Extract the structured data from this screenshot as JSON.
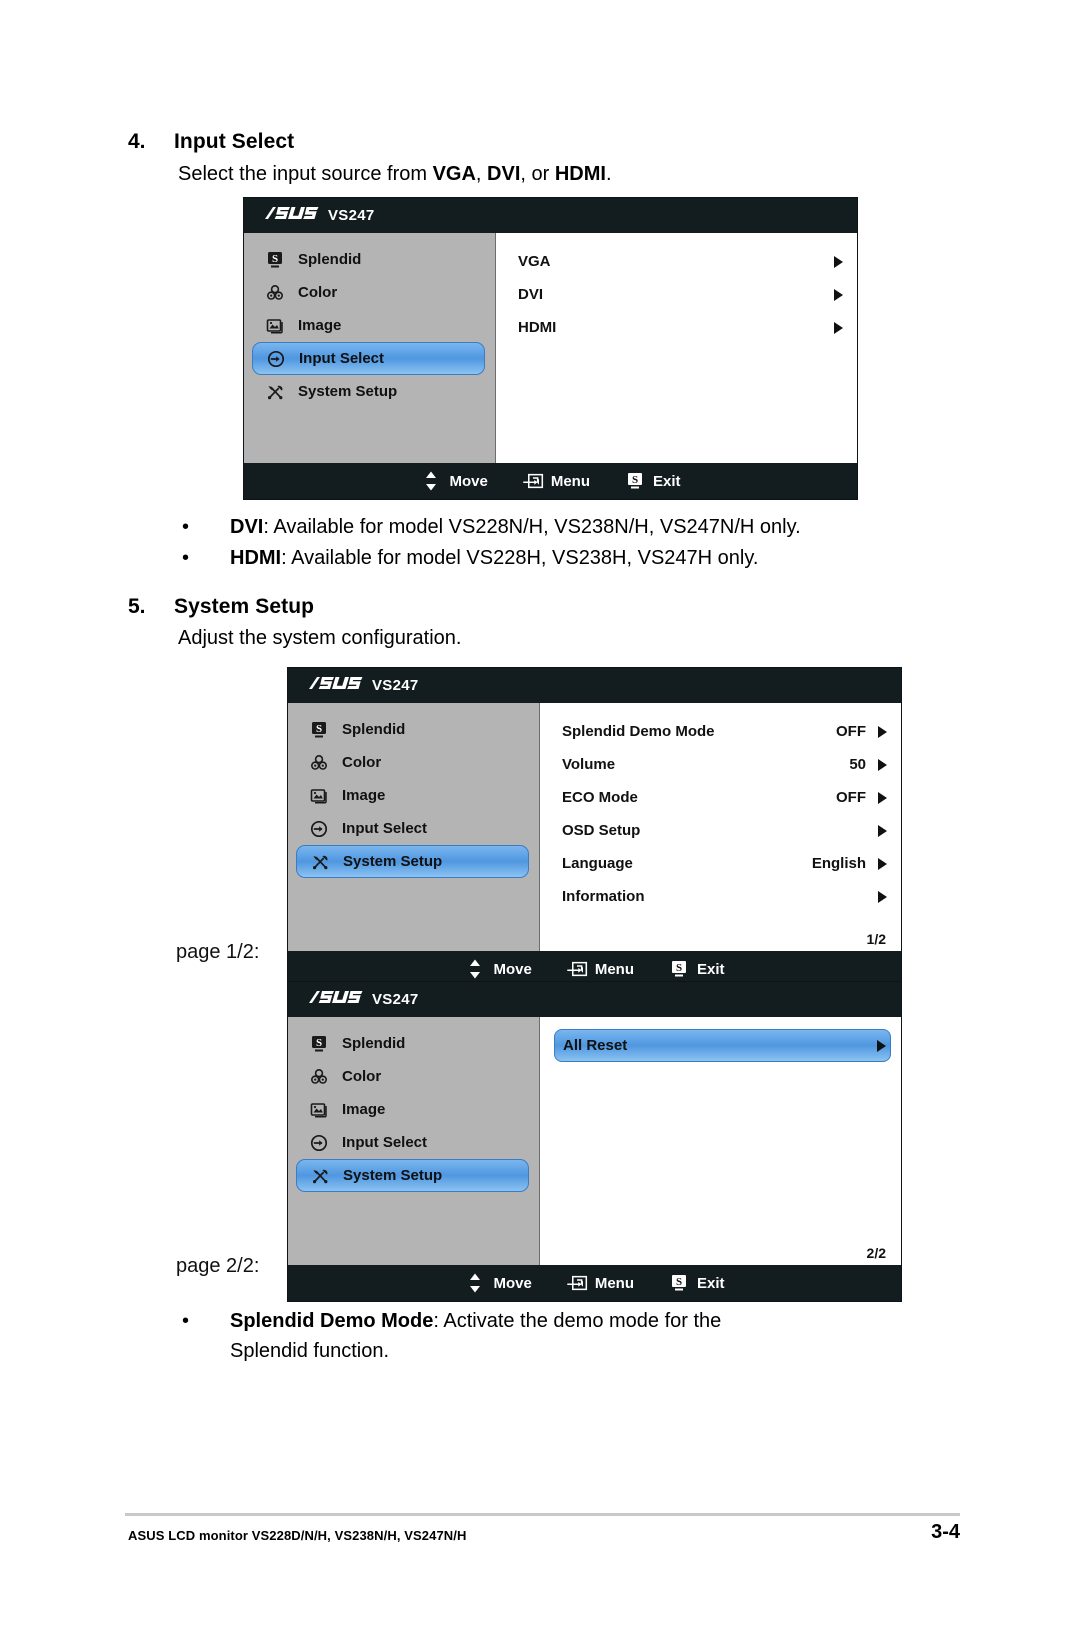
{
  "section4": {
    "number": "4.",
    "title": "Input Select",
    "desc_pre": "Select the input source from ",
    "desc_b1": "VGA",
    "desc_mid1": ", ",
    "desc_b2": "DVI",
    "desc_mid2": ", or ",
    "desc_b3": "HDMI",
    "desc_end": "."
  },
  "osd1": {
    "logo": "/ISUS",
    "model": "VS247",
    "menu": [
      {
        "label": "Splendid",
        "icon": "splendid-icon",
        "selected": false
      },
      {
        "label": "Color",
        "icon": "color-icon",
        "selected": false
      },
      {
        "label": "Image",
        "icon": "image-icon",
        "selected": false
      },
      {
        "label": "Input Select",
        "icon": "input-select-icon",
        "selected": true
      },
      {
        "label": "System Setup",
        "icon": "system-setup-icon",
        "selected": false
      }
    ],
    "options": [
      {
        "label": "VGA",
        "value": "",
        "arrow": true,
        "selected": false
      },
      {
        "label": "DVI",
        "value": "",
        "arrow": true,
        "selected": false
      },
      {
        "label": "HDMI",
        "value": "",
        "arrow": true,
        "selected": false
      }
    ],
    "page_indicator": "",
    "footer": [
      {
        "label": "Move",
        "icon": "up-down-arrows-icon"
      },
      {
        "label": "Menu",
        "icon": "enter-key-icon"
      },
      {
        "label": "Exit",
        "icon": "splendid-s-icon"
      }
    ]
  },
  "bullets_after_osd1": [
    {
      "dot": "•",
      "bold": "DVI",
      "rest": ": Available for model VS228N/H, VS238N/H, VS247N/H only."
    },
    {
      "dot": "•",
      "bold": "HDMI",
      "rest": ": Available for model VS228H, VS238H, VS247H only."
    }
  ],
  "section5": {
    "number": "5.",
    "title": "System Setup",
    "desc": "Adjust the system configuration."
  },
  "osd2": {
    "logo": "/ISUS",
    "model": "VS247",
    "menu": [
      {
        "label": "Splendid",
        "icon": "splendid-icon",
        "selected": false
      },
      {
        "label": "Color",
        "icon": "color-icon",
        "selected": false
      },
      {
        "label": "Image",
        "icon": "image-icon",
        "selected": false
      },
      {
        "label": "Input Select",
        "icon": "input-select-icon",
        "selected": false
      },
      {
        "label": "System Setup",
        "icon": "system-setup-icon",
        "selected": true
      }
    ],
    "options": [
      {
        "label": "Splendid Demo Mode",
        "value": "OFF",
        "arrow": true,
        "selected": false
      },
      {
        "label": "Volume",
        "value": "50",
        "arrow": true,
        "selected": false
      },
      {
        "label": "ECO Mode",
        "value": "OFF",
        "arrow": true,
        "selected": false
      },
      {
        "label": "OSD Setup",
        "value": "",
        "arrow": true,
        "selected": false
      },
      {
        "label": "Language",
        "value": "English",
        "arrow": true,
        "selected": false
      },
      {
        "label": "Information",
        "value": "",
        "arrow": true,
        "selected": false
      }
    ],
    "page_indicator": "1/2",
    "footer": [
      {
        "label": "Move",
        "icon": "up-down-arrows-icon"
      },
      {
        "label": "Menu",
        "icon": "enter-key-icon"
      },
      {
        "label": "Exit",
        "icon": "splendid-s-icon"
      }
    ]
  },
  "osd3": {
    "logo": "/ISUS",
    "model": "VS247",
    "menu": [
      {
        "label": "Splendid",
        "icon": "splendid-icon",
        "selected": false
      },
      {
        "label": "Color",
        "icon": "color-icon",
        "selected": false
      },
      {
        "label": "Image",
        "icon": "image-icon",
        "selected": false
      },
      {
        "label": "Input Select",
        "icon": "input-select-icon",
        "selected": false
      },
      {
        "label": "System Setup",
        "icon": "system-setup-icon",
        "selected": true
      }
    ],
    "options": [
      {
        "label": "All Reset",
        "value": "",
        "arrow": true,
        "selected": true
      }
    ],
    "page_indicator": "2/2",
    "footer": [
      {
        "label": "Move",
        "icon": "up-down-arrows-icon"
      },
      {
        "label": "Menu",
        "icon": "enter-key-icon"
      },
      {
        "label": "Exit",
        "icon": "splendid-s-icon"
      }
    ]
  },
  "page_labels": {
    "page1": "page 1/2:",
    "page2": "page 2/2:"
  },
  "bullet_bottom": {
    "dot": "•",
    "bold": "Splendid Demo Mode",
    "rest": ": Activate the demo mode for the",
    "line2": "Splendid function."
  },
  "page_footer": {
    "left": "ASUS LCD monitor VS228D/N/H, VS238N/H, VS247N/H",
    "right": "3-4"
  },
  "colors": {
    "osd_dark": "#131c1f",
    "osd_sidebar": "#b4b4b4",
    "highlight_blue": "#4f97e0"
  }
}
